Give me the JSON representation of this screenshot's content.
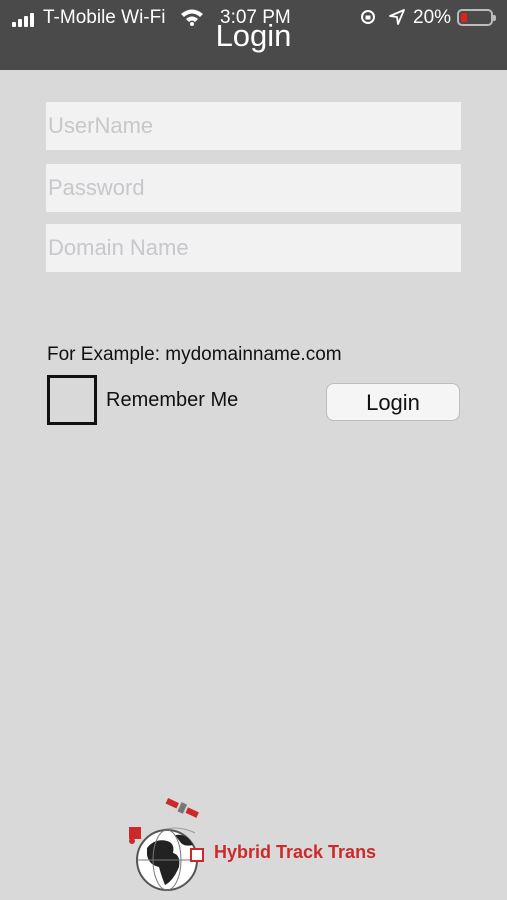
{
  "status_bar": {
    "carrier": "T-Mobile Wi-Fi",
    "time": "3:07 PM",
    "battery_percent": "20%",
    "battery_level": 0.2,
    "icons": [
      "signal-icon",
      "wifi-icon",
      "orientation-lock-icon",
      "location-icon",
      "battery-icon"
    ]
  },
  "header": {
    "title": "Login"
  },
  "form": {
    "username_placeholder": "UserName",
    "password_placeholder": "Password",
    "domain_placeholder": "Domain Name",
    "example_text": "For Example: mydomainname.com",
    "remember_label": "Remember Me",
    "login_label": "Login"
  },
  "footer": {
    "logo_text": "Hybrid Track Trans"
  },
  "colors": {
    "header_bg": "#4a4a4a",
    "page_bg": "#d9d9d9",
    "brand_red": "#cc2a2a"
  }
}
